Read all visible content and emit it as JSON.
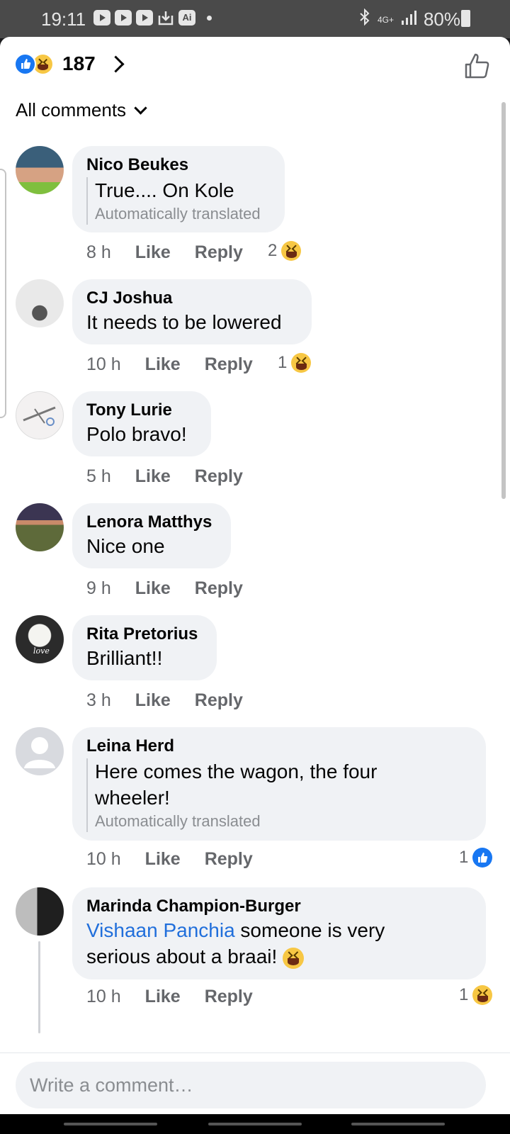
{
  "status_bar": {
    "time": "19:11",
    "network": "4G+",
    "battery": "80%"
  },
  "header": {
    "reaction_count": "187",
    "filter_label": "All comments"
  },
  "comments": [
    {
      "author": "Nico Beukes",
      "text": "True.... On Kole",
      "translated_label": "Automatically translated",
      "time": "8 h",
      "like": "Like",
      "reply": "Reply",
      "reaction_count": "2",
      "reaction": "haha"
    },
    {
      "author": "CJ Joshua",
      "text": "It needs to be lowered",
      "time": "10 h",
      "like": "Like",
      "reply": "Reply",
      "reaction_count": "1",
      "reaction": "haha"
    },
    {
      "author": "Tony Lurie",
      "text": "Polo bravo!",
      "time": "5 h",
      "like": "Like",
      "reply": "Reply"
    },
    {
      "author": "Lenora Matthys",
      "text": "Nice one",
      "time": "9 h",
      "like": "Like",
      "reply": "Reply"
    },
    {
      "author": "Rita Pretorius",
      "text": "Brilliant!!",
      "time": "3 h",
      "like": "Like",
      "reply": "Reply",
      "avatar_text": "love"
    },
    {
      "author": "Leina Herd",
      "text_line1": "Here comes the wagon, the four",
      "text_line2": "wheeler!",
      "translated_label": "Automatically translated",
      "time": "10 h",
      "like": "Like",
      "reply": "Reply",
      "reaction_count": "1",
      "reaction": "like"
    },
    {
      "author": "Marinda Champion-Burger",
      "mention": "Vishaan Panchia",
      "text_after_mention": " someone is very",
      "text_line2": "serious about a braai! ",
      "time": "10 h",
      "like": "Like",
      "reply": "Reply",
      "reaction_count": "1",
      "reaction": "haha"
    }
  ],
  "composer": {
    "placeholder": "Write a comment…"
  },
  "colors": {
    "accent": "#1877f2",
    "bubble": "#f0f2f5",
    "muted": "#65676b",
    "mention": "#216fdb"
  }
}
